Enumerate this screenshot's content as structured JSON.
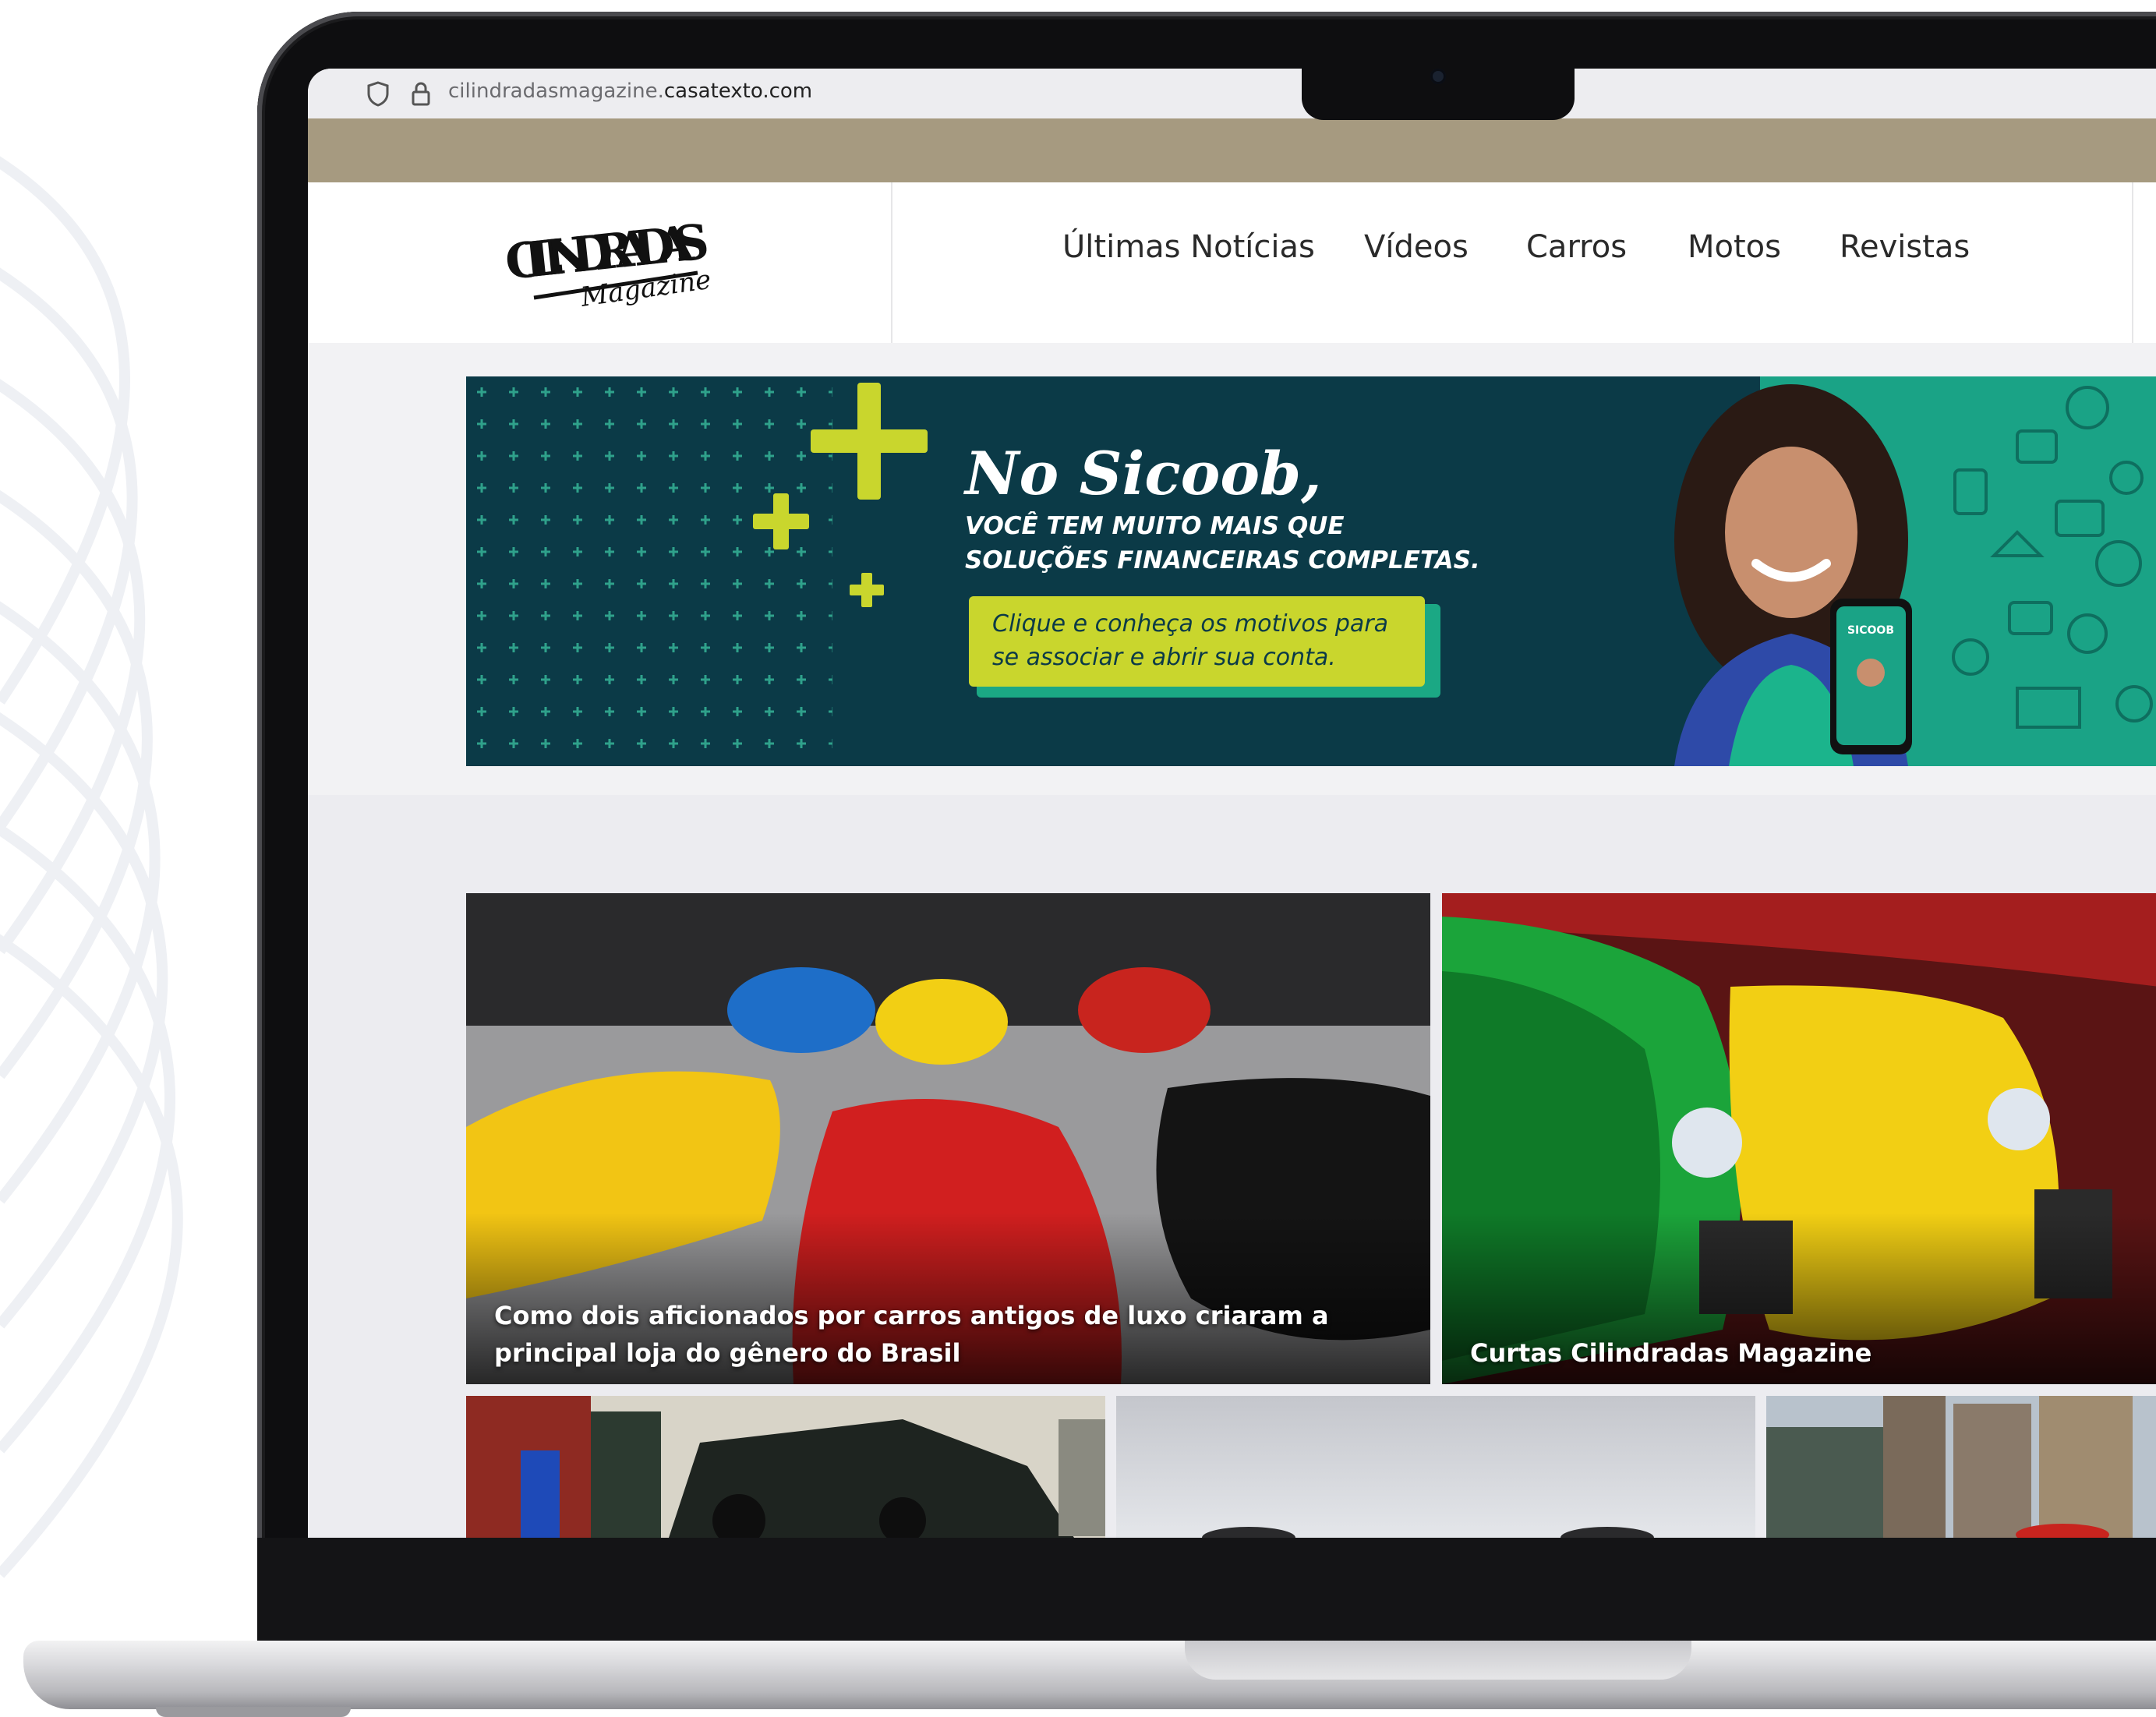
{
  "browser": {
    "url_domain_prefix": "cilindradasmagazine.",
    "url_domain_suffix": "casatexto.com"
  },
  "site": {
    "logo_main": "CILINDRADAS",
    "logo_sub": "Magazine"
  },
  "nav": {
    "items": [
      {
        "label": "Últimas Notícias"
      },
      {
        "label": "Vídeos"
      },
      {
        "label": "Carros"
      },
      {
        "label": "Motos"
      },
      {
        "label": "Revistas"
      }
    ]
  },
  "banner": {
    "title": "No Sicoob,",
    "subtitle_line1": "VOCÊ TEM MUITO MAIS QUE",
    "subtitle_line2": "SOLUÇÕES FINANCEIRAS COMPLETAS.",
    "cta_line1": "Clique e conheça os motivos para",
    "cta_line2": "se associar e abrir sua conta.",
    "phone_brand": "SICOOB",
    "colors": {
      "background": "#0b3a47",
      "accent_yellow": "#c9d62d",
      "accent_teal": "#1aa386"
    }
  },
  "articles": {
    "featured": [
      {
        "title": "Como dois aficionados por carros antigos de luxo criaram a principal loja do gênero do Brasil"
      },
      {
        "title": "Curtas Cilindradas Magazine"
      }
    ]
  },
  "colors": {
    "top_strip": "#a69a80",
    "page_bg": "#ececf0"
  }
}
